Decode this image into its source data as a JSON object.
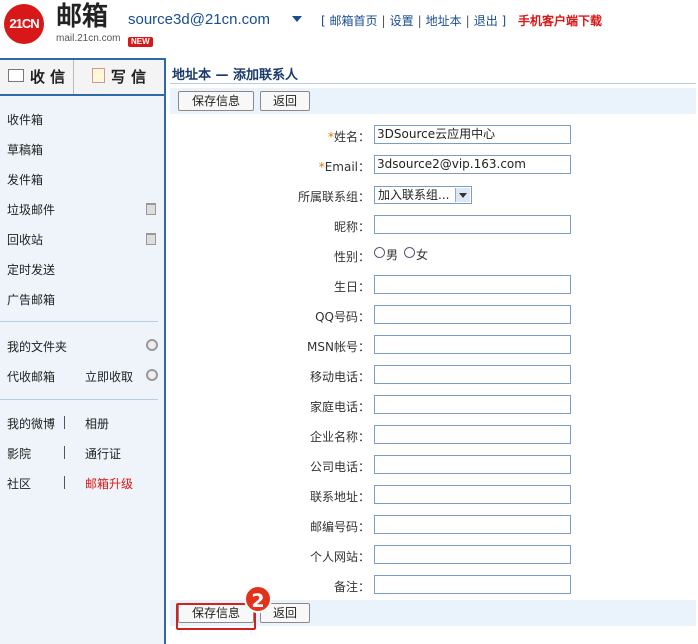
{
  "header": {
    "logo_mark": "21CN",
    "logo_title": "邮箱",
    "logo_sub": "mail.21cn.com",
    "new_badge": "NEW",
    "account": "source3d@21cn.com",
    "nav": [
      "邮箱首页",
      "设置",
      "地址本",
      "退出"
    ],
    "mobile_link": "手机客户端下载",
    "brand_color": "#d81818",
    "link_color": "#1a4d8f"
  },
  "sidebar": {
    "inbox_label": "收 信",
    "write_label": "写 信",
    "folders": [
      "收件箱",
      "草稿箱",
      "发件箱",
      "垃圾邮件",
      "回收站",
      "定时发送",
      "广告邮箱"
    ],
    "my_folders": "我的文件夹",
    "proxy_mail": "代收邮箱",
    "fetch_now": "立即收取",
    "links_left": [
      "我的微博",
      "影院",
      "社区"
    ],
    "links_right": [
      "相册",
      "通行证",
      "邮箱升级"
    ]
  },
  "main": {
    "title": "地址本 — 添加联系人",
    "save_label": "保存信息",
    "back_label": "返回",
    "step_number": "2",
    "form": {
      "name_label": "姓名：",
      "name_value": "3DSource云应用中心",
      "email_label": "Email：",
      "email_value": "3dsource2@vip.163.com",
      "group_label": "所属联系组：",
      "group_value": "加入联系组...",
      "nickname_label": "昵称：",
      "gender_label": "性别：",
      "gender_male": "男",
      "gender_female": "女",
      "birthday_label": "生日：",
      "qq_label": "QQ号码：",
      "msn_label": "MSN帐号：",
      "mobile_label": "移动电话：",
      "home_phone_label": "家庭电话：",
      "company_label": "企业名称：",
      "office_phone_label": "公司电话：",
      "address_label": "联系地址：",
      "zip_label": "邮编号码：",
      "website_label": "个人网站：",
      "note_label": "备注："
    }
  }
}
